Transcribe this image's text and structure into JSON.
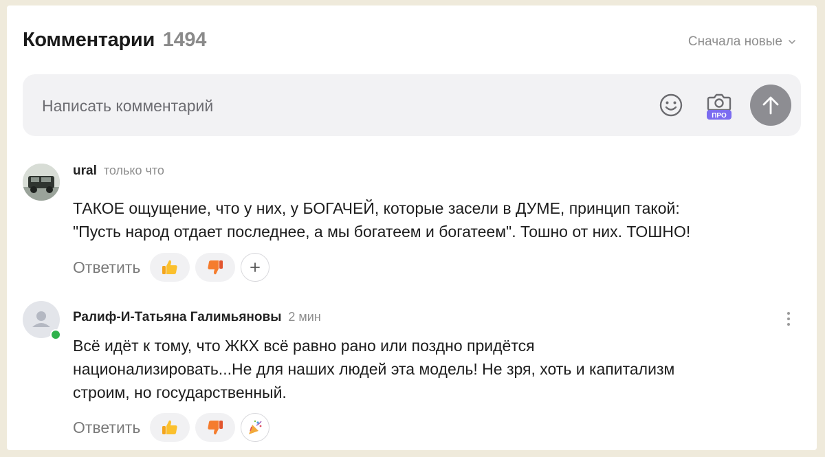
{
  "header": {
    "title": "Комментарии",
    "count": "1494",
    "sort_label": "Сначала новые"
  },
  "composer": {
    "placeholder": "Написать комментарий",
    "camera_badge": "ПРО"
  },
  "comments": [
    {
      "author": "ural",
      "time": "только что",
      "lines": [
        "ТАКОЕ ощущение, что у них, у БОГАЧЕЙ, которые засели в ДУМЕ, принцип такой:",
        "\"Пусть народ отдает последнее, а мы богатеем и богатеем\". Тошно от них. ТОШНО!"
      ],
      "reply_label": "Ответить"
    },
    {
      "author": "Ралиф-И-Татьяна Галимьяновы",
      "time": "2 мин",
      "lines": [
        "Всё идёт к тому, что ЖКХ всё равно рано или поздно придётся",
        "национализировать...Не для наших людей эта модель! Не зря, хоть и капитализм",
        "строим, но государственный."
      ],
      "reply_label": "Ответить"
    }
  ],
  "colors": {
    "page_background": "#efeadb",
    "card": "#ffffff",
    "composer_bg": "#f2f2f4",
    "send_button": "#8d8d92",
    "online": "#2fb14b",
    "pro_badge": "#7b6cf0"
  },
  "icons": [
    "chevron-down-icon",
    "smile-icon",
    "camera-icon",
    "arrow-up-icon",
    "thumbs-up-icon",
    "thumbs-down-icon",
    "plus-icon",
    "party-popper-icon",
    "more-vertical-icon",
    "user-icon"
  ]
}
